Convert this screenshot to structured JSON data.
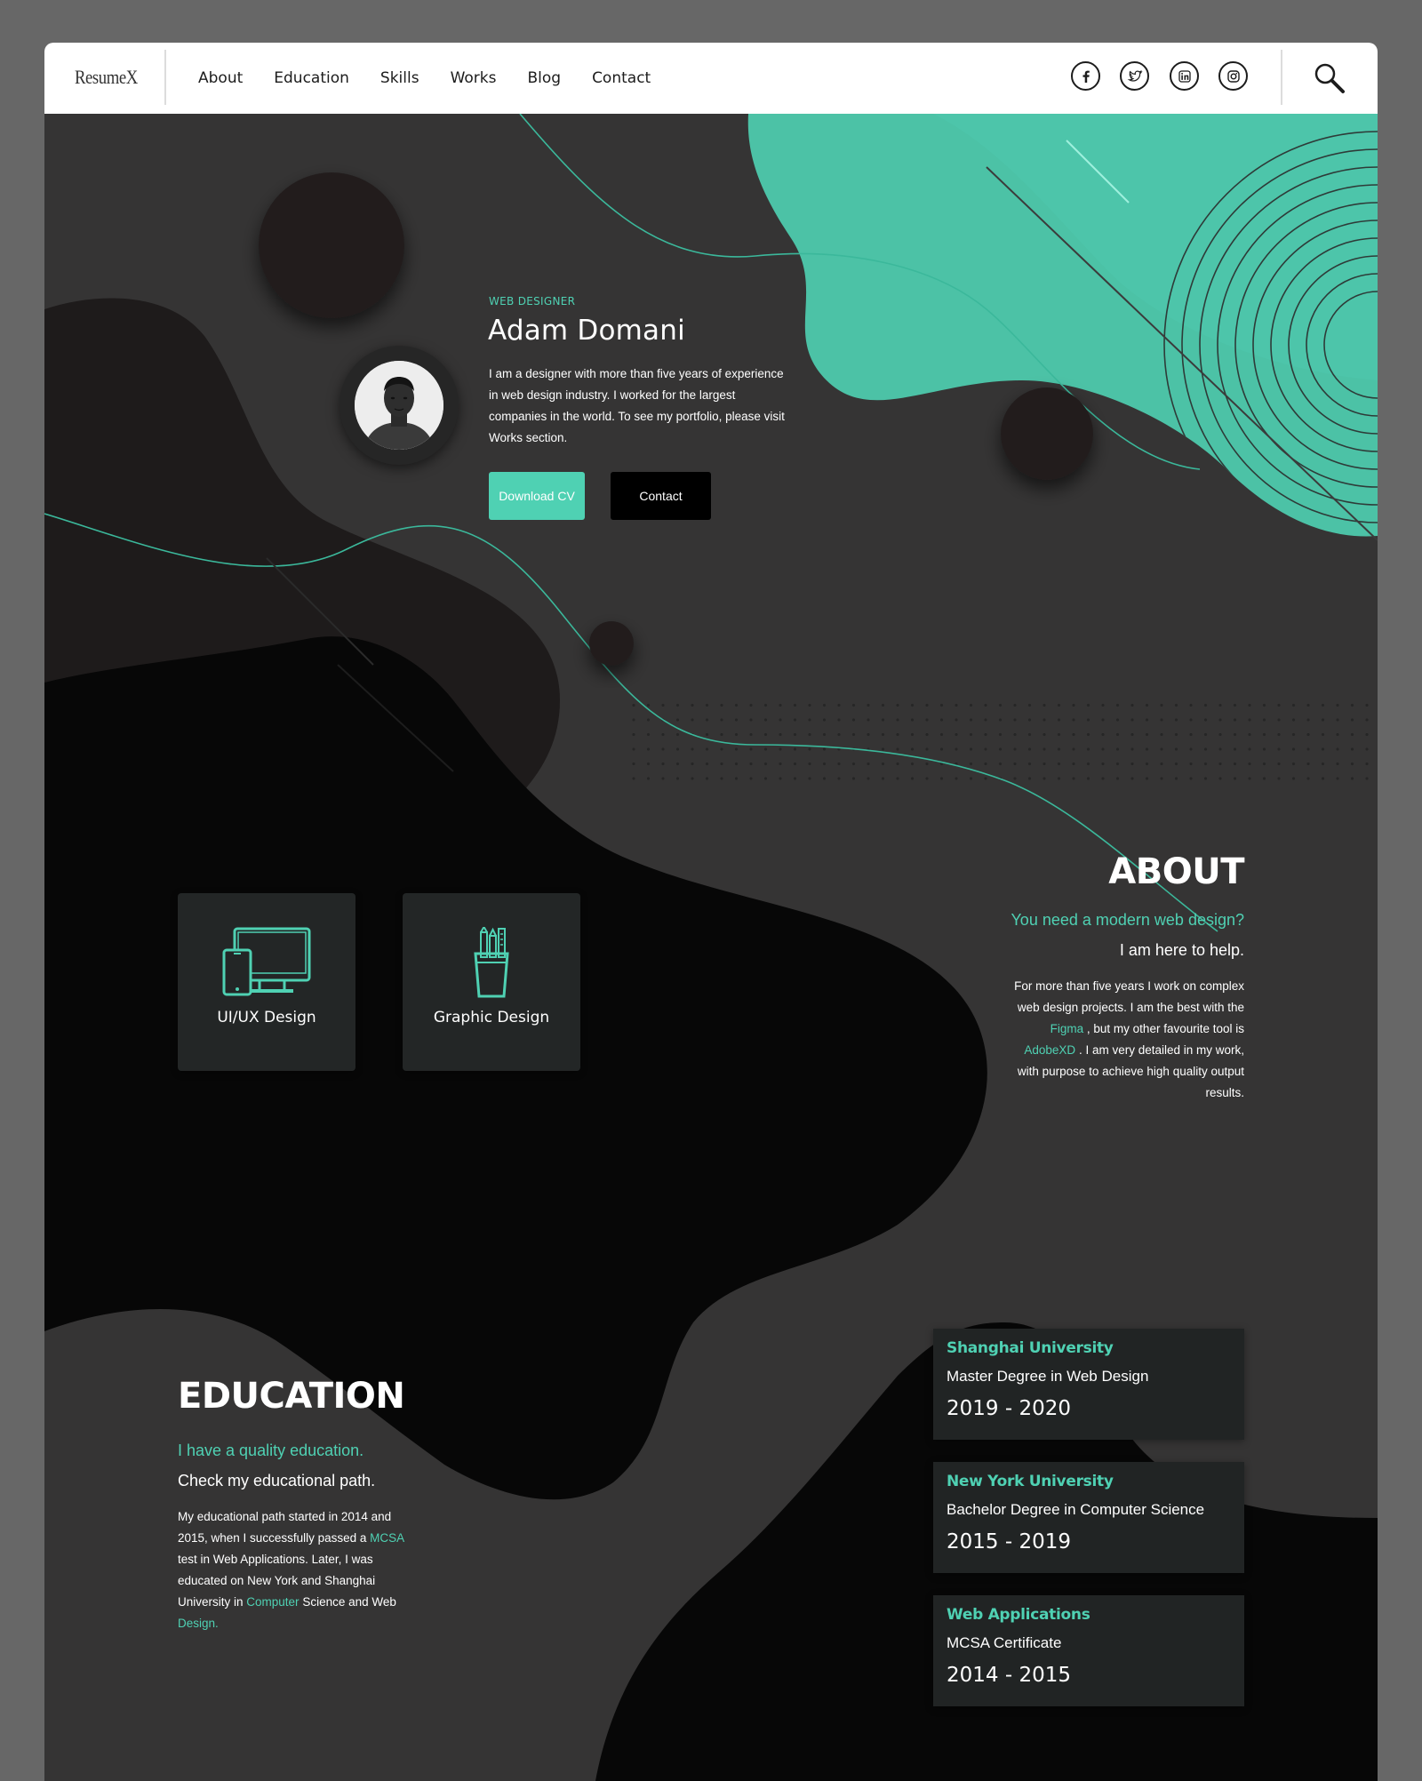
{
  "brand": {
    "logo": "ResumeX"
  },
  "nav": {
    "items": [
      "About",
      "Education",
      "Skills",
      "Works",
      "Blog",
      "Contact"
    ]
  },
  "social": {
    "icons": [
      "facebook-icon",
      "twitter-icon",
      "linkedin-icon",
      "instagram-icon"
    ]
  },
  "colors": {
    "accent": "#4fd1b3",
    "dark_bg": "#353434",
    "black": "#000000",
    "card": "#232626"
  },
  "hero": {
    "role": "WEB DESIGNER",
    "name": "Adam Domani",
    "bio": "I am a designer with more than five years of experience in web design industry. I worked for the largest companies in the world. To see my portfolio, please visit Works section.",
    "download_label": "Download CV",
    "contact_label": "Contact"
  },
  "about": {
    "title": "ABOUT",
    "sub1": "You need a modern web design?",
    "sub2": "I am here to help.",
    "text_a": "For more than five years I work on complex web design projects. I am the best with the ",
    "link1": "Figma",
    "text_b": " , but my other favourite tool is ",
    "link2": "AdobeXD",
    "text_c": " . I am very detailed in my work, with purpose to achieve high quality output results."
  },
  "skills": {
    "cards": [
      {
        "label": "UI/UX Design"
      },
      {
        "label": "Graphic Design"
      }
    ]
  },
  "education": {
    "title": "EDUCATION",
    "sub1": "I have a quality education.",
    "sub2": "Check my educational path.",
    "text_a": "My educational path started in 2014 and 2015, when I successfully passed a ",
    "link1": "MCSA",
    "text_b": " test in Web Applications. Later, I was educated on New York and Shanghai University in ",
    "link2": "Computer",
    "text_c": " Science and Web ",
    "link3": "Design.",
    "entries": [
      {
        "school": "Shanghai University",
        "degree": "Master Degree in Web Design",
        "years": "2019 - 2020"
      },
      {
        "school": "New York University",
        "degree": "Bachelor Degree in Computer Science",
        "years": "2015 - 2019"
      },
      {
        "school": "Web Applications",
        "degree": "MCSA Certificate",
        "years": "2014 - 2015"
      }
    ]
  }
}
